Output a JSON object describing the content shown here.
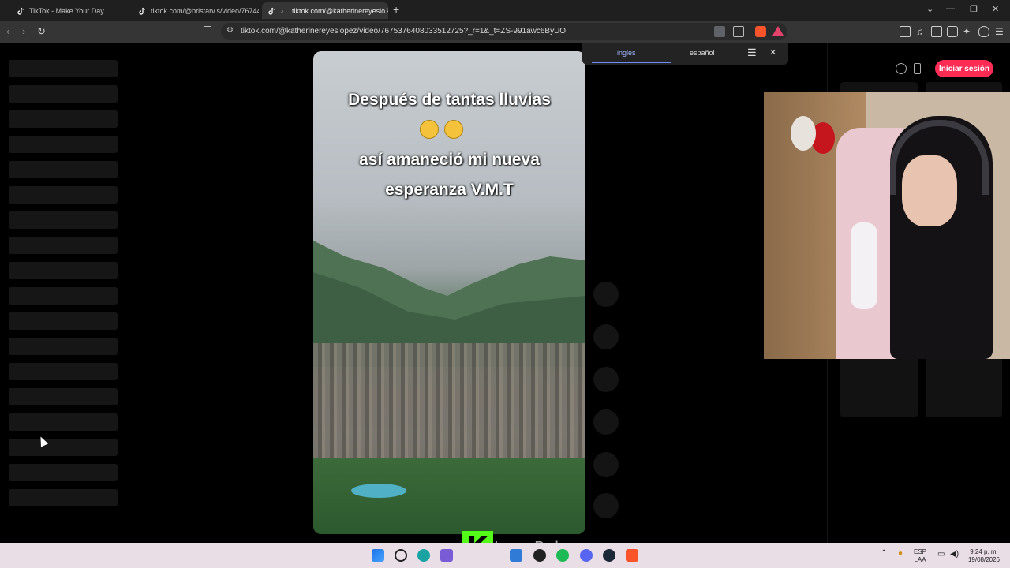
{
  "browser": {
    "tabs": [
      {
        "title": "TikTok - Make Your Day",
        "active": false
      },
      {
        "title": "tiktok.com/@bristarv.s/video/76744",
        "active": false
      },
      {
        "title": "tiktok.com/@katherinereyeslo",
        "active": true
      }
    ],
    "url": "tiktok.com/@katherinereyeslopez/video/7675376408033512725?_r=1&_t=ZS-991awc6ByUO"
  },
  "translate_bar": {
    "lang_source": "inglés",
    "lang_target": "español"
  },
  "video": {
    "caption_line1": "Después de tantas lluvias",
    "caption_line3": "así amaneció mi nueva",
    "caption_line4": "esperanza V.M.T"
  },
  "header": {
    "login_label": "Iniciar sesión"
  },
  "stream_overlay": {
    "logo_letter": "K",
    "streamer_name": "JessyBaby"
  },
  "taskbar": {
    "language": "ESP",
    "layout": "LAA",
    "time": "9:24 p. m.",
    "date": "19/08/2026"
  },
  "colors": {
    "accent_red": "#fe2c55",
    "kick_green": "#53fc18"
  }
}
